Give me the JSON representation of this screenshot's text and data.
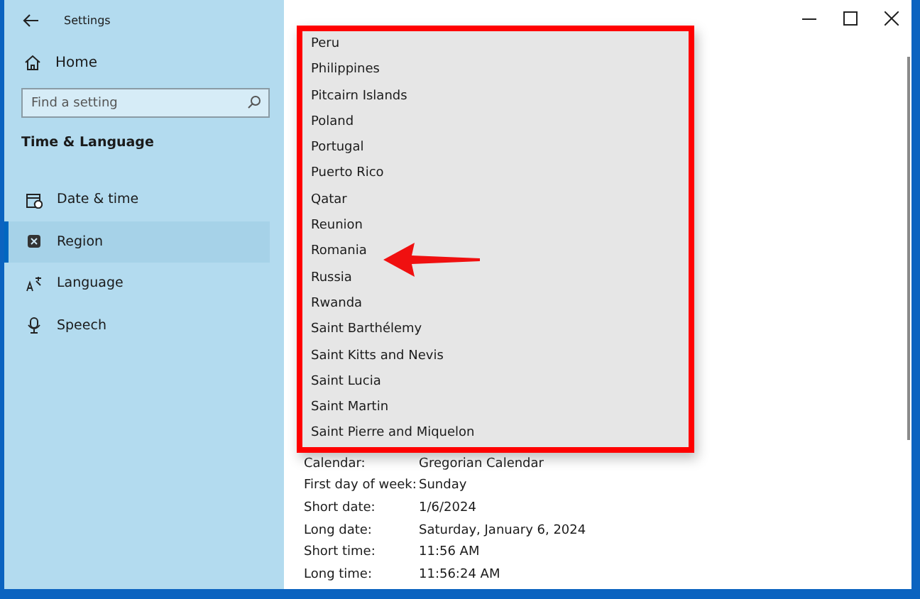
{
  "window": {
    "title": "Settings"
  },
  "sidebar": {
    "home": "Home",
    "search": {
      "placeholder": "Find a setting"
    },
    "section": "Time & Language",
    "items": [
      {
        "label": "Date & time",
        "selected": false
      },
      {
        "label": "Region",
        "selected": true
      },
      {
        "label": "Language",
        "selected": false
      },
      {
        "label": "Speech",
        "selected": false
      }
    ]
  },
  "dropdown": {
    "options": [
      "Peru",
      "Philippines",
      "Pitcairn Islands",
      "Poland",
      "Portugal",
      "Puerto Rico",
      "Qatar",
      "Reunion",
      "Romania",
      "Russia",
      "Rwanda",
      "Saint Barthélemy",
      "Saint Kitts and Nevis",
      "Saint Lucia",
      "Saint Martin",
      "Saint Pierre and Miquelon"
    ]
  },
  "formats": [
    {
      "label": "Calendar:",
      "value": "Gregorian Calendar"
    },
    {
      "label": "First day of week:",
      "value": "Sunday"
    },
    {
      "label": "Short date:",
      "value": "1/6/2024"
    },
    {
      "label": "Long date:",
      "value": "Saturday, January 6, 2024"
    },
    {
      "label": "Short time:",
      "value": "11:56 AM"
    },
    {
      "label": "Long time:",
      "value": "11:56:24 AM"
    }
  ]
}
